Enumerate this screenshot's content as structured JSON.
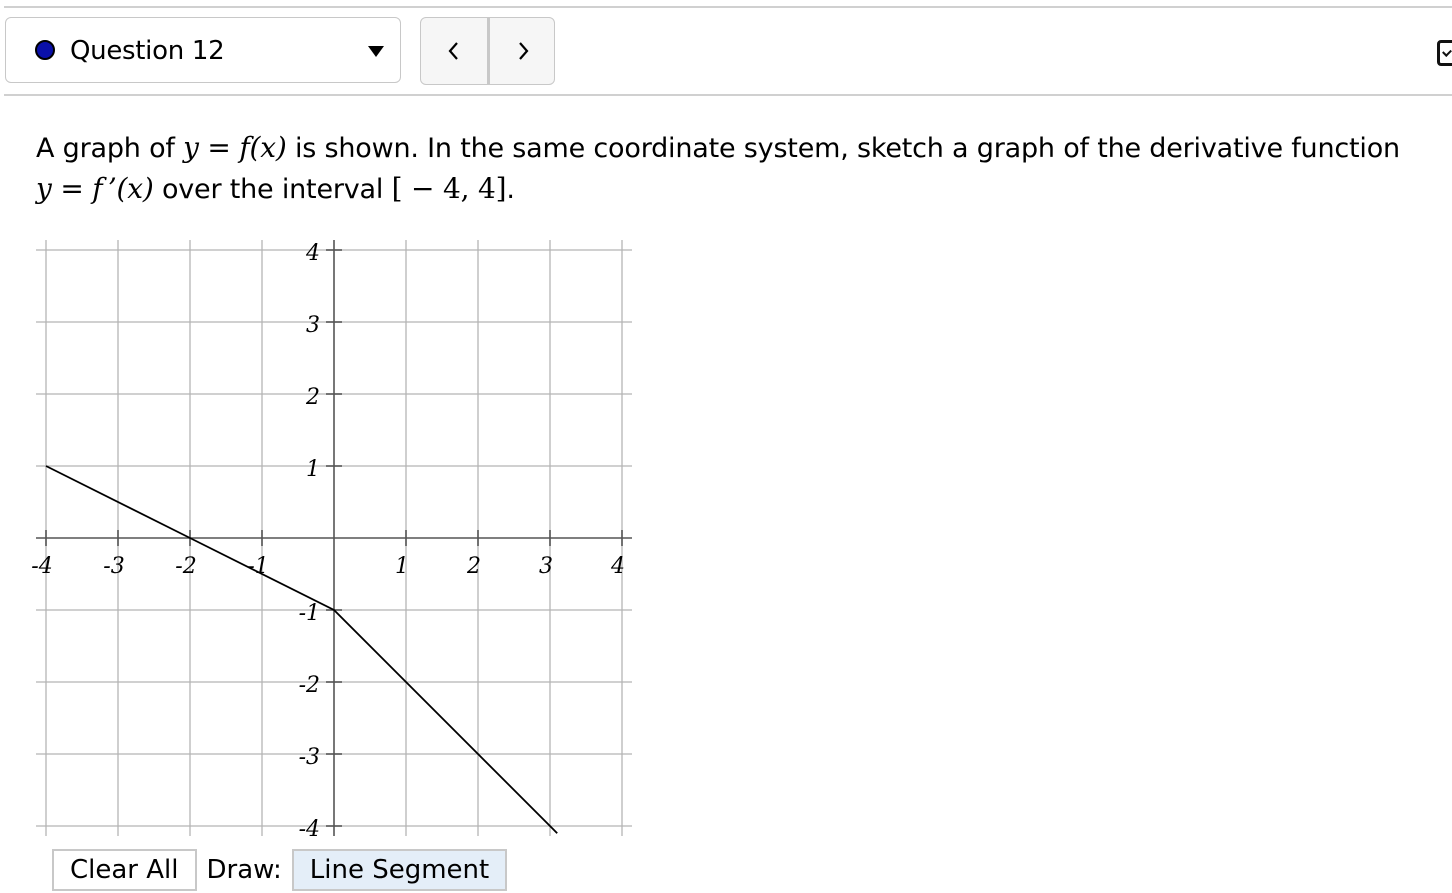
{
  "header": {
    "question_label": "Question 12",
    "status_dot_color": "#0a10a8",
    "prev_label": "previous-question",
    "next_label": "next-question"
  },
  "prompt": {
    "text1": "A graph of ",
    "math1": "y = f(x)",
    "text2": " is shown. In the same coordinate system, sketch a graph of the derivative function",
    "math2": "y = f ’(x)",
    "text3": " over the interval ",
    "math3": "[ − 4, 4]",
    "text4": "."
  },
  "toolbar": {
    "clear_label": "Clear All",
    "draw_label": "Draw:",
    "tool_label": "Line Segment"
  },
  "chart_data": {
    "type": "line",
    "title": "",
    "xlabel": "",
    "ylabel": "",
    "xlim": [
      -4,
      4
    ],
    "ylim": [
      -4,
      4
    ],
    "grid": true,
    "x_ticks": [
      -4,
      -3,
      -2,
      -1,
      1,
      2,
      3,
      4
    ],
    "x_tick_labels": [
      "-4",
      "-3",
      "-2",
      "-1",
      "1",
      "2",
      "3",
      "4"
    ],
    "y_ticks": [
      4,
      3,
      2,
      1,
      -1,
      -2,
      -3,
      -4
    ],
    "y_tick_labels": [
      "4",
      "3",
      "2",
      "1",
      "-1",
      "-2",
      "-3",
      "-4"
    ],
    "series": [
      {
        "name": "f(x)",
        "color": "#000000",
        "x": [
          -4,
          -2,
          0,
          1,
          2,
          3,
          3.1
        ],
        "y": [
          1,
          0,
          -1,
          -2,
          -3,
          -4,
          -4.1
        ]
      }
    ]
  }
}
